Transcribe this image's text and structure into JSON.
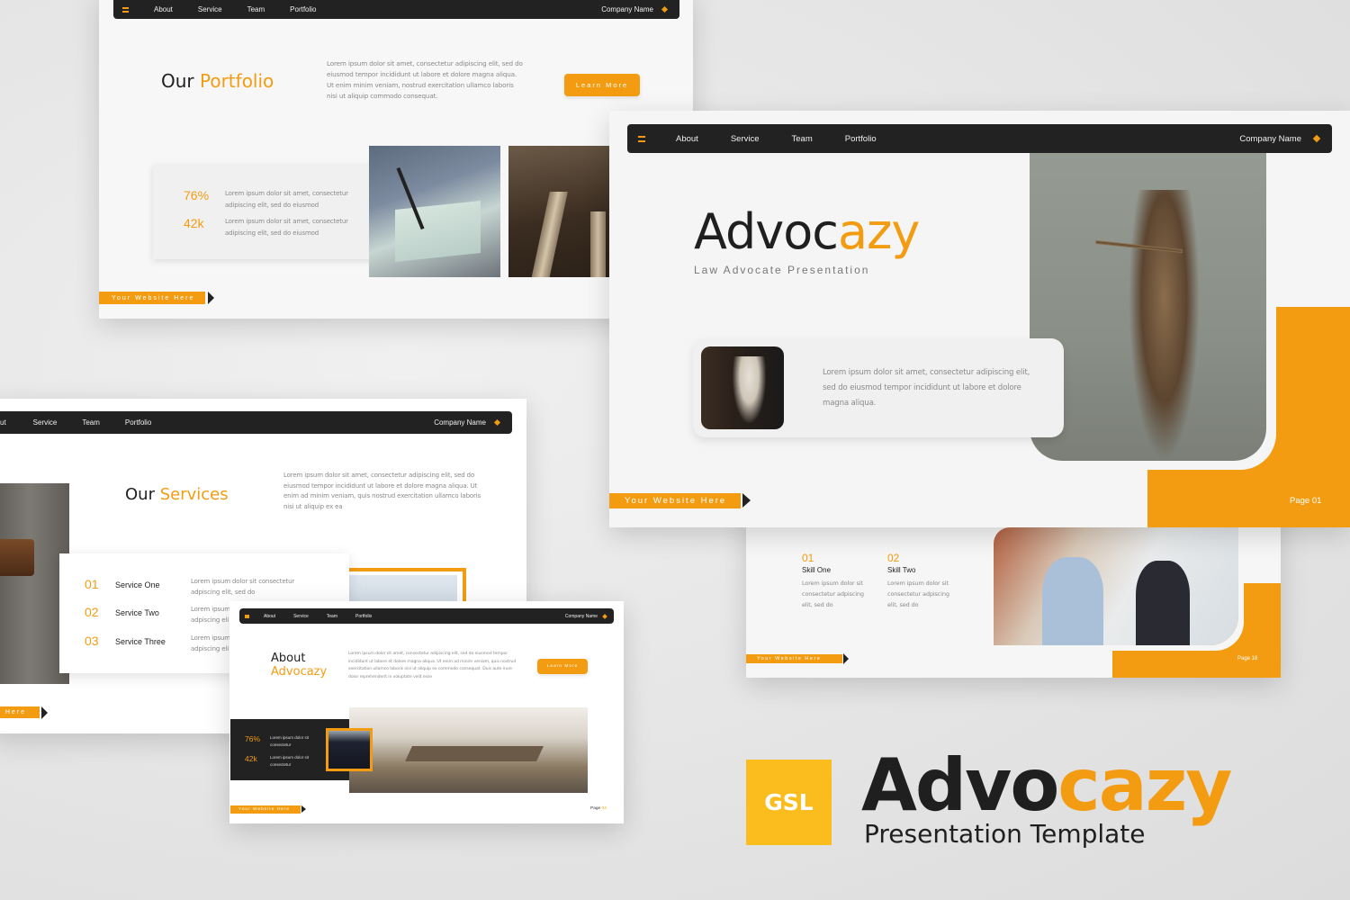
{
  "nav": {
    "items": [
      "About",
      "Service",
      "Team",
      "Portfolio"
    ],
    "company": "Company Name",
    "menu_icon": "hamburger-icon",
    "brand_icon": "diamond-icon"
  },
  "colors": {
    "accent": "#f39c12",
    "dark": "#222222",
    "background": "#f7f7f7",
    "gsl_badge": "#fbbc1e"
  },
  "website_tag": "Your Website Here",
  "portfolio_slide": {
    "title_part1": "Our",
    "title_part2": "Portfolio",
    "body": "Lorem ipsum dolor sit amet, consectetur adipiscing elit, sed do eiusmod tempor incididunt ut labore et dolore magna aliqua. Ut enim minim veniam, nostrud exercitation ullamco laboris nisi ut aliquip commodo consequat.",
    "button": "Learn More",
    "stats": [
      {
        "value": "76%",
        "text": "Lorem ipsum dolor sit amet, consectetur adipiscing elit, sed do eiusmod"
      },
      {
        "value": "42k",
        "text": "Lorem ipsum dolor sit amet, consectetur adipiscing elit, sed do eiusmod"
      }
    ]
  },
  "cover_slide": {
    "title_part1": "Advoc",
    "title_part2": "azy",
    "subtitle": "Law Advocate Presentation",
    "body": "Lorem ipsum dolor sit amet, consectetur adipiscing elit, sed do eiusmod tempor incididunt ut labore et dolore magna aliqua.",
    "page": "Page 01"
  },
  "services_slide": {
    "title_part1": "Our",
    "title_part2": "Services",
    "body": "Lorem ipsum dolor sit amet, consectetur adipiscing elit, sed do eiusmod tempor incididunt ut labore et dolore magna aliqua. Ut enim ad minim veniam, quis nostrud exercitation ullamco laboris nisi ut aliquip ex ea",
    "nav_first_partial": "ut",
    "website_partial": "e Here",
    "services": [
      {
        "num": "01",
        "name": "Service One",
        "text": "Lorem ipsum dolor sit consectetur adpiscing elit, sed do"
      },
      {
        "num": "02",
        "name": "Service Two",
        "text": "Lorem ipsum adpiscing eli"
      },
      {
        "num": "03",
        "name": "Service Three",
        "text": "Lorem ipsum adpiscing eli"
      }
    ]
  },
  "about_slide": {
    "title_line1": "About",
    "title_line2": "Advocazy",
    "body": "Lorem ipsum dolor sit amet, consectetur adipiscing elit, sed do eiusmod tempor incididunt ut labore et dolore magna aliqua. Ut enim ad minim veniam, quis nostrud exercitation ullamco laboris nisi ut aliquip ex commodo consequat. Duis aute irure dolor reprehenderit in voluptate velit esse",
    "button": "Learn More",
    "stats": [
      {
        "value": "76%",
        "text": "Lorem ipsum dolor sit consectetur"
      },
      {
        "value": "42k",
        "text": "Lorem ipsum dolor sit consectetur"
      }
    ],
    "page_label": "Page",
    "page_num": "04"
  },
  "skills_slide": {
    "skills": [
      {
        "num": "01",
        "name": "Skill One",
        "text": "Lorem ipsum dolor sit consectetur adpiscing elit, sed do"
      },
      {
        "num": "02",
        "name": "Skill Two",
        "text": "Lorem ipsum dolor sit consectetur adpiscing elit, sed do"
      }
    ],
    "page": "Page 18"
  },
  "branding": {
    "badge": "GSL",
    "title_part1": "Advo",
    "title_part2": "cazy",
    "subtitle": "Presentation Template"
  }
}
